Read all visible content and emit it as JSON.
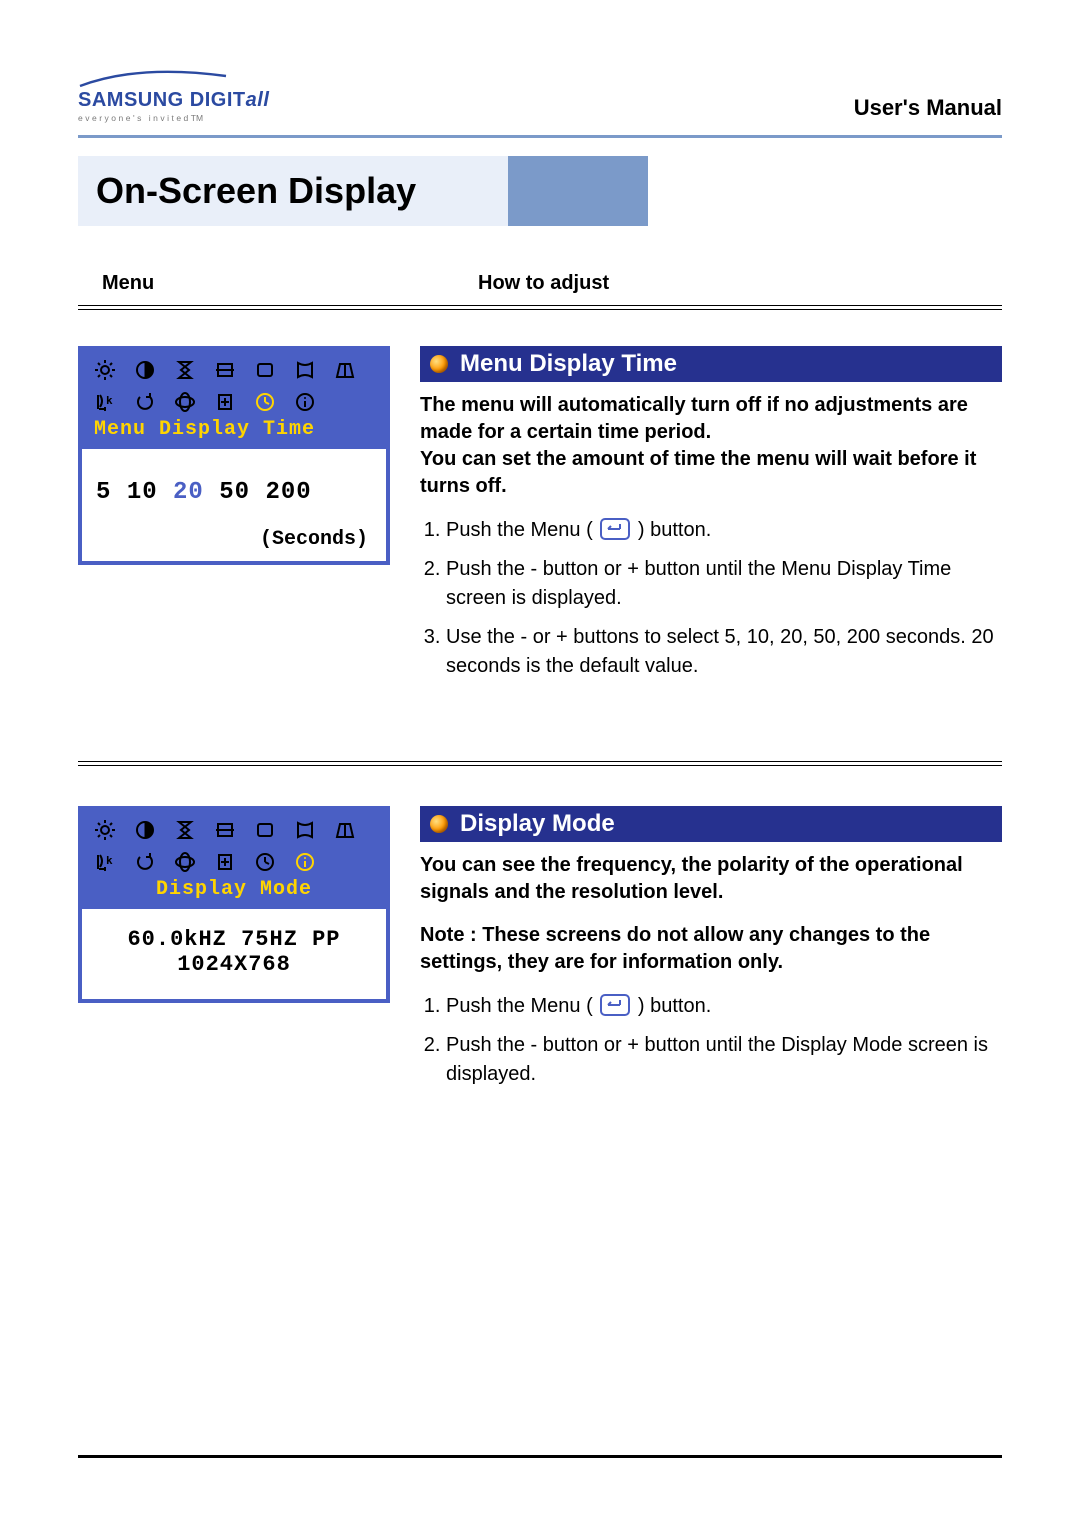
{
  "header": {
    "logo_brand": "SAMSUNG",
    "logo_sub": "DIGIT",
    "logo_script": "all",
    "logo_tag": "everyone's invited",
    "tm": "TM",
    "users_manual": "User's Manual"
  },
  "page_title": "On-Screen Display",
  "column_headers": {
    "menu": "Menu",
    "how": "How to adjust"
  },
  "section1": {
    "osd": {
      "title": "Menu Display Time",
      "options": [
        "5",
        "10",
        "20",
        "50",
        "200"
      ],
      "active_index": 2,
      "seconds_label": "(Seconds)"
    },
    "title": "Menu Display Time",
    "intro": "The menu will automatically turn off if no adjustments are made for a certain time period.\nYou can set the amount of time the menu will wait before it turns off.",
    "steps": [
      {
        "pre": "Push the Menu ( ",
        "post": " ) button."
      },
      {
        "text": "Push the - button or + button until the Menu Display Time screen is displayed."
      },
      {
        "text": "Use the - or + buttons to select 5, 10, 20, 50, 200 seconds. 20 seconds is the default value."
      }
    ]
  },
  "section2": {
    "osd": {
      "title": "Display Mode",
      "line1": "60.0kHZ 75HZ PP",
      "line2": "1024X768"
    },
    "title": "Display Mode",
    "intro": "You can see the frequency, the polarity of the operational signals and the resolution level.",
    "note": "Note :  These screens do not allow any changes to the settings, they are for information only.",
    "steps": [
      {
        "pre": "Push the Menu ( ",
        "post": " ) button."
      },
      {
        "text": "Push the - button or + button until the Display Mode screen is displayed."
      }
    ]
  }
}
